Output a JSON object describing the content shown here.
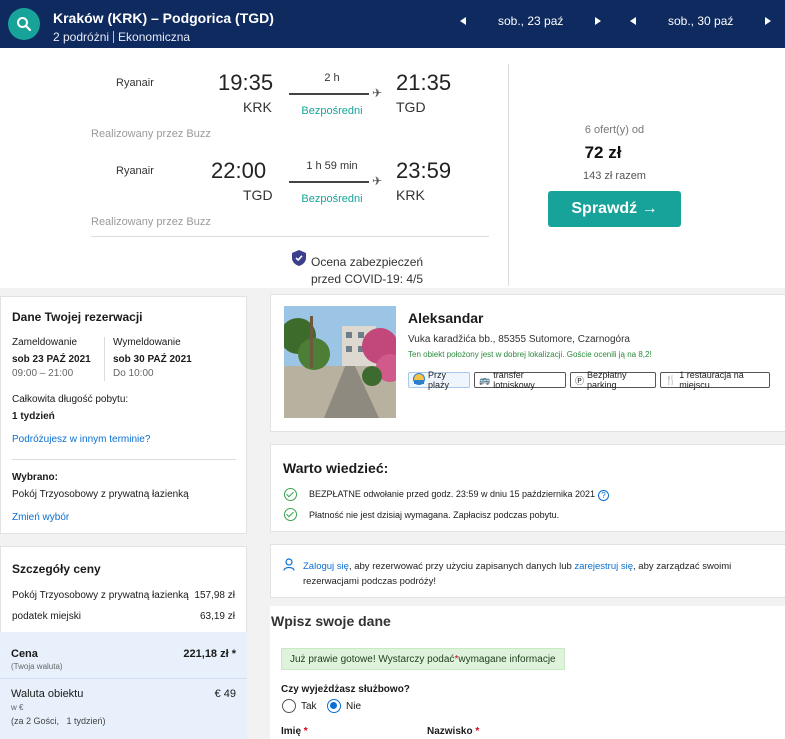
{
  "header": {
    "route": "Kraków (KRK) – Podgorica (TGD)",
    "travellers": "2 podróżni",
    "cabin": "Ekonomiczna",
    "depart_date": "sob., 23 paź",
    "return_date": "sob., 30 paź"
  },
  "flights": [
    {
      "airline": "Ryanair",
      "dep_time": "19:35",
      "dep_airport": "KRK",
      "duration": "2 h",
      "stops": "Bezpośredni",
      "arr_time": "21:35",
      "arr_airport": "TGD",
      "operated_by": "Realizowany przez Buzz"
    },
    {
      "airline": "Ryanair",
      "dep_time": "22:00",
      "dep_airport": "TGD",
      "duration": "1 h 59 min",
      "stops": "Bezpośredni",
      "arr_time": "23:59",
      "arr_airport": "KRK",
      "operated_by": "Realizowany przez Buzz"
    }
  ],
  "covid": {
    "line1": "Ocena zabezpieczeń",
    "line2": "przed COVID-19: 4/5"
  },
  "offer": {
    "count": "6 ofert(y) od",
    "price": "72 zł",
    "total": "143 zł razem",
    "button": "Sprawdź →"
  },
  "reservation": {
    "title": "Dane Twojej rezerwacji",
    "checkin_label": "Zameldowanie",
    "checkin_date": "sob 23 PAŹ 2021",
    "checkin_time": "09:00 – 21:00",
    "checkout_label": "Wymeldowanie",
    "checkout_date": "sob 30 PAŹ 2021",
    "checkout_time": "Do 10:00",
    "stay_label": "Całkowita długość pobytu:",
    "stay_value": "1 tydzień",
    "other_dates_link": "Podróżujesz w innym terminie?",
    "chosen_label": "Wybrano:",
    "chosen_value": "Pokój Trzyosobowy z prywatną łazienką",
    "change_link": "Zmień wybór"
  },
  "price_details": {
    "title": "Szczegóły ceny",
    "rows": [
      {
        "label": "Pokój Trzyosobowy z prywatną łazienką",
        "value": "157,98 zł"
      },
      {
        "label": "podatek miejski",
        "value": "63,19 zł"
      }
    ],
    "total_label": "Cena",
    "total_sub": "(Twoja waluta)",
    "total_value": "221,18 zł *",
    "hotel_currency_label": "Waluta obiektu",
    "hotel_currency_value": "€ 49",
    "hotel_currency_sub1": "w €",
    "hotel_currency_sub2": "(za 2 Gości,   1 tydzień)"
  },
  "hotel": {
    "name": "Aleksandar",
    "address": "Vuka karadžića bb., 85355 Sutomore, Czarnogóra",
    "location_note": "Ten obiekt położony jest w dobrej lokalizacji. Goście ocenili ją na 8,2!",
    "amenities": [
      "Przy plaży",
      "transfer lotniskowy",
      "Bezpłatny parking",
      "1 restauracja na miejscu"
    ]
  },
  "good_to_know": {
    "title": "Warto wiedzieć:",
    "item1_bold": "BEZPŁATNE",
    "item1_rest": " odwołanie przed godz. 23:59 w dniu 15 października 2021",
    "item2": "Płatność nie jest dzisiaj wymagana. Zapłacisz podczas pobytu."
  },
  "login": {
    "link1": "Zaloguj się",
    "text1": ", aby rezerwować przy użyciu zapisanych danych lub ",
    "link2": "zarejestruj się",
    "text2": ", aby zarządzać swoimi",
    "line2": "rezerwacjami podczas podróży!"
  },
  "form": {
    "title": "Wpisz swoje dane",
    "notice_pre": "Już prawie gotowe! Wystarczy podać ",
    "notice_star": "*",
    "notice_post": " wymagane informacje",
    "business_question": "Czy wyjeżdżasz służbowo?",
    "yes": "Tak",
    "no": "Nie",
    "first_name": "Imię",
    "last_name": "Nazwisko",
    "required_mark": "*"
  },
  "colors": {
    "navy": "#0e2a5e",
    "teal": "#17a39a",
    "link": "#0a6fd1",
    "green": "#3aa34f"
  }
}
